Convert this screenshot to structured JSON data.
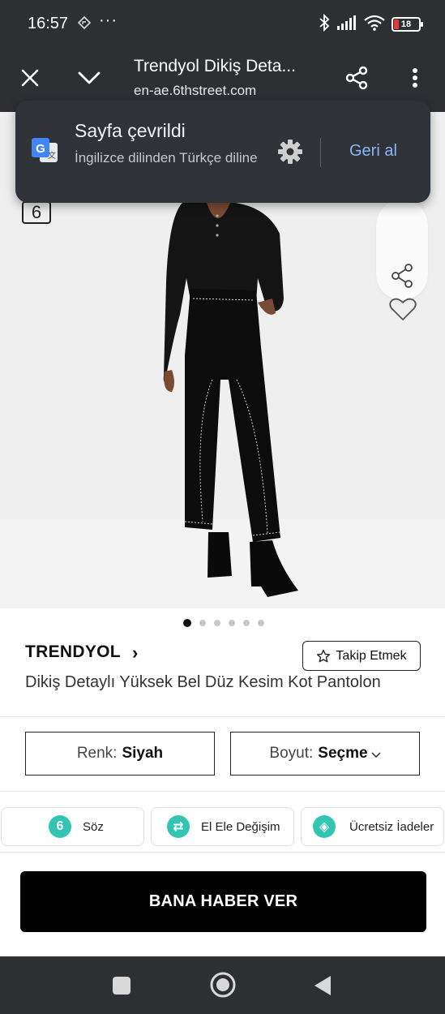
{
  "status_bar": {
    "time": "16:57",
    "more": "···",
    "battery": "18"
  },
  "toolbar": {
    "title": "Trendyol Dikiş Deta...",
    "url": "en-ae.6thstreet.com"
  },
  "translate_popup": {
    "title": "Sayfa çevrildi",
    "subtitle": "İngilizce dilinden Türkçe diline",
    "undo_label": "Geri al"
  },
  "product": {
    "badge": "6",
    "carousel": {
      "count": 6,
      "active": 1
    },
    "brand": "TRENDYOL",
    "brand_chevron": "›",
    "follow_label": "Takip Etmek",
    "title": "Dikiş Detaylı Yüksek Bel Düz Kesim Kot Pantolon"
  },
  "selectors": {
    "color_label": "Renk:",
    "color_value": "Siyah",
    "size_label": "Boyut:",
    "size_value": "Seçme"
  },
  "benefits": [
    {
      "label": "Söz",
      "icon": "six-icon",
      "glyph": "6"
    },
    {
      "label": "El Ele Değişim",
      "icon": "exchange-icon",
      "glyph": "⇄"
    },
    {
      "label": "Ücretsiz İadeler",
      "icon": "free-return-icon",
      "glyph": "◈"
    }
  ],
  "cta": {
    "label": "BANA HABER VER"
  },
  "colors": {
    "chrome_bg": "#2d2f33",
    "popup_bg": "#2f3236",
    "link_blue": "#8ab4f8",
    "teal": "#33c5b1",
    "cta_bg": "#000000"
  }
}
